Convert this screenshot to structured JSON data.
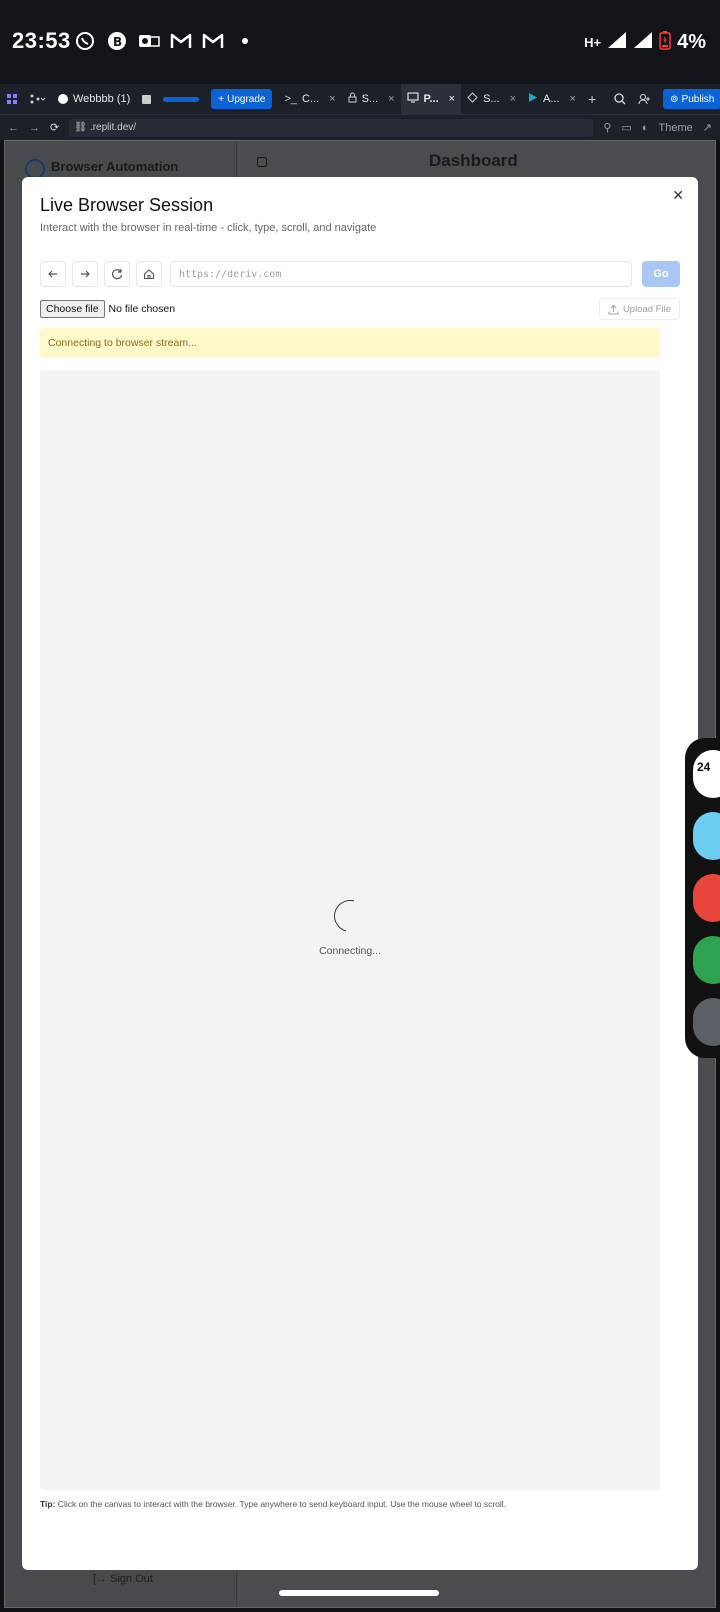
{
  "status_bar": {
    "time": "23:53",
    "battery": "4%",
    "network": "H+",
    "notif_icons": [
      "whatsapp-icon",
      "b-icon",
      "outlook-icon",
      "gmail-icon",
      "gmail-icon",
      "dot-icon"
    ]
  },
  "replit_bar": {
    "tabs": [
      {
        "label": "Webbbb (1)"
      },
      {
        "label": "C..."
      },
      {
        "label": "S..."
      },
      {
        "label": "P..."
      },
      {
        "label": "S..."
      },
      {
        "label": "A..."
      }
    ],
    "upgrade_label": "Upgrade",
    "publish_label": "Publish",
    "theme_label": "Theme",
    "url": ".replit.dev/"
  },
  "background_app": {
    "sidebar_title": "Browser Automation",
    "main_title": "Dashboard",
    "sign_out": "Sign Out"
  },
  "modal": {
    "title": "Live Browser Session",
    "subtitle": "Interact with the browser in real-time - click, type, scroll, and navigate",
    "url_placeholder": "https://deriv.com",
    "go_label": "Go",
    "choose_file_label": "Choose file",
    "no_file_label": "No file chosen",
    "upload_label": "Upload File",
    "alert_text": "Connecting to browser stream...",
    "connecting_text": "Connecting...",
    "tip_label": "Tip:",
    "tip_text": " Click on the canvas to interact with the browser. Type anywhere to send keyboard input. Use the mouse wheel to scroll."
  },
  "dock": {
    "calendar_day": "24"
  },
  "colors": {
    "accent": "#0b63d6",
    "go_disabled": "#a8c7f5",
    "alert_bg": "#fff9c9",
    "alert_text": "#8a6a1f",
    "canvas_bg": "#f2f3f5"
  }
}
